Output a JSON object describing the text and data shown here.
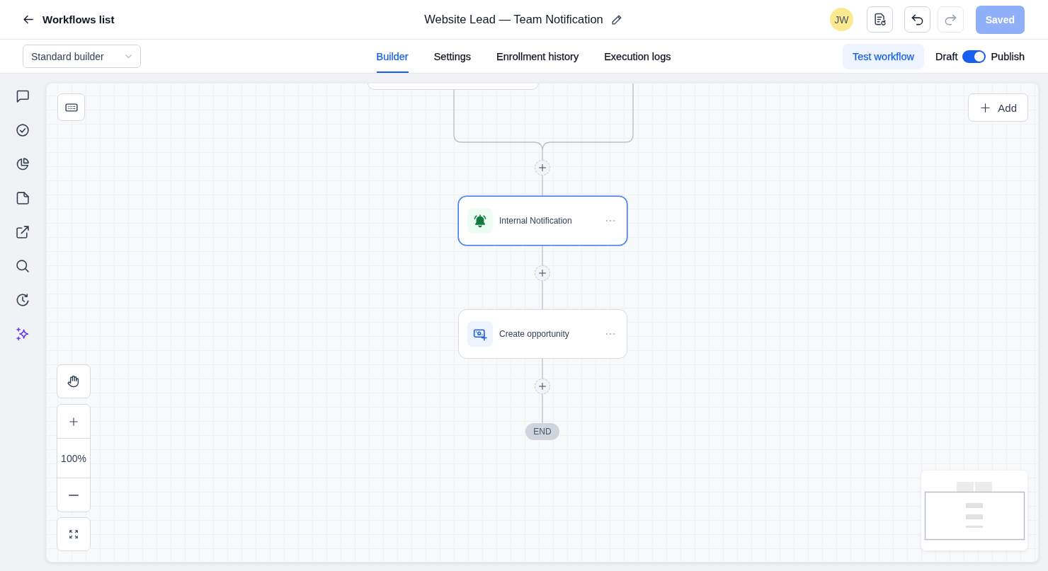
{
  "header": {
    "back_link": "Workflows list",
    "title": "Website Lead — Team Notification",
    "avatar": "JW",
    "undo": {
      "disabled": false
    },
    "redo": {
      "disabled": true
    },
    "save_button": {
      "label": "Saved",
      "disabled": true
    }
  },
  "builder_select": {
    "value": "Standard builder"
  },
  "tabs": [
    {
      "label": "Builder",
      "selected": true
    },
    {
      "label": "Settings",
      "selected": false
    },
    {
      "label": "Enrollment history",
      "selected": false
    },
    {
      "label": "Execution logs",
      "selected": false
    }
  ],
  "test_button": "Test workflow",
  "publish_toggle": {
    "off_label": "Draft",
    "on_label": "Publish",
    "on": true
  },
  "canvas": {
    "add_button": "Add",
    "zoom_level": "100%",
    "nodes": [
      {
        "kind": "notification",
        "label": "Internal Notification",
        "selected": true
      },
      {
        "kind": "opportunity",
        "label": "Create opportunity",
        "selected": false
      }
    ],
    "end_label": "END"
  }
}
